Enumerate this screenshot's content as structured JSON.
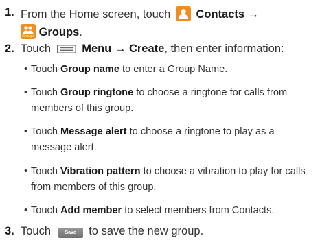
{
  "steps": [
    {
      "number": "1.",
      "line1": {
        "prefix": "From the Home screen, touch",
        "bold": "Contacts →"
      },
      "line2": {
        "icon_caption": "Groups",
        "bold": "Groups",
        "suffix": "."
      }
    },
    {
      "number": "2.",
      "prefix": "Touch",
      "bold": "Menu → Create",
      "suffix": ", then enter information:",
      "bullets": [
        {
          "bold": "Group name",
          "text_line1": " to enter a Group Name.",
          "text_line2": ""
        },
        {
          "bold": "Group ringtone",
          "text_line1": " to choose a ringtone for calls from",
          "text_line2": "members of this group."
        },
        {
          "bold": "Message alert",
          "text_line1": " to choose a ringtone to play as a",
          "text_line2": "message alert."
        },
        {
          "bold": "Vibration pattern",
          "text_line1": " to choose a vibration to play for calls",
          "text_line2": "from members of this group."
        },
        {
          "bold": "Add member",
          "text_line1": " to select members from Contacts.",
          "text_line2": ""
        }
      ],
      "bullet_lead": "Touch"
    },
    {
      "number": "3.",
      "prefix": "Touch",
      "button_label": "Save",
      "suffix": "to save the new group."
    }
  ],
  "icons": [
    "contacts-icon",
    "groups-icon",
    "menu-icon"
  ],
  "colors": {
    "accent": "#f28c1e",
    "text": "#333333",
    "button": "#7f7f7f"
  }
}
